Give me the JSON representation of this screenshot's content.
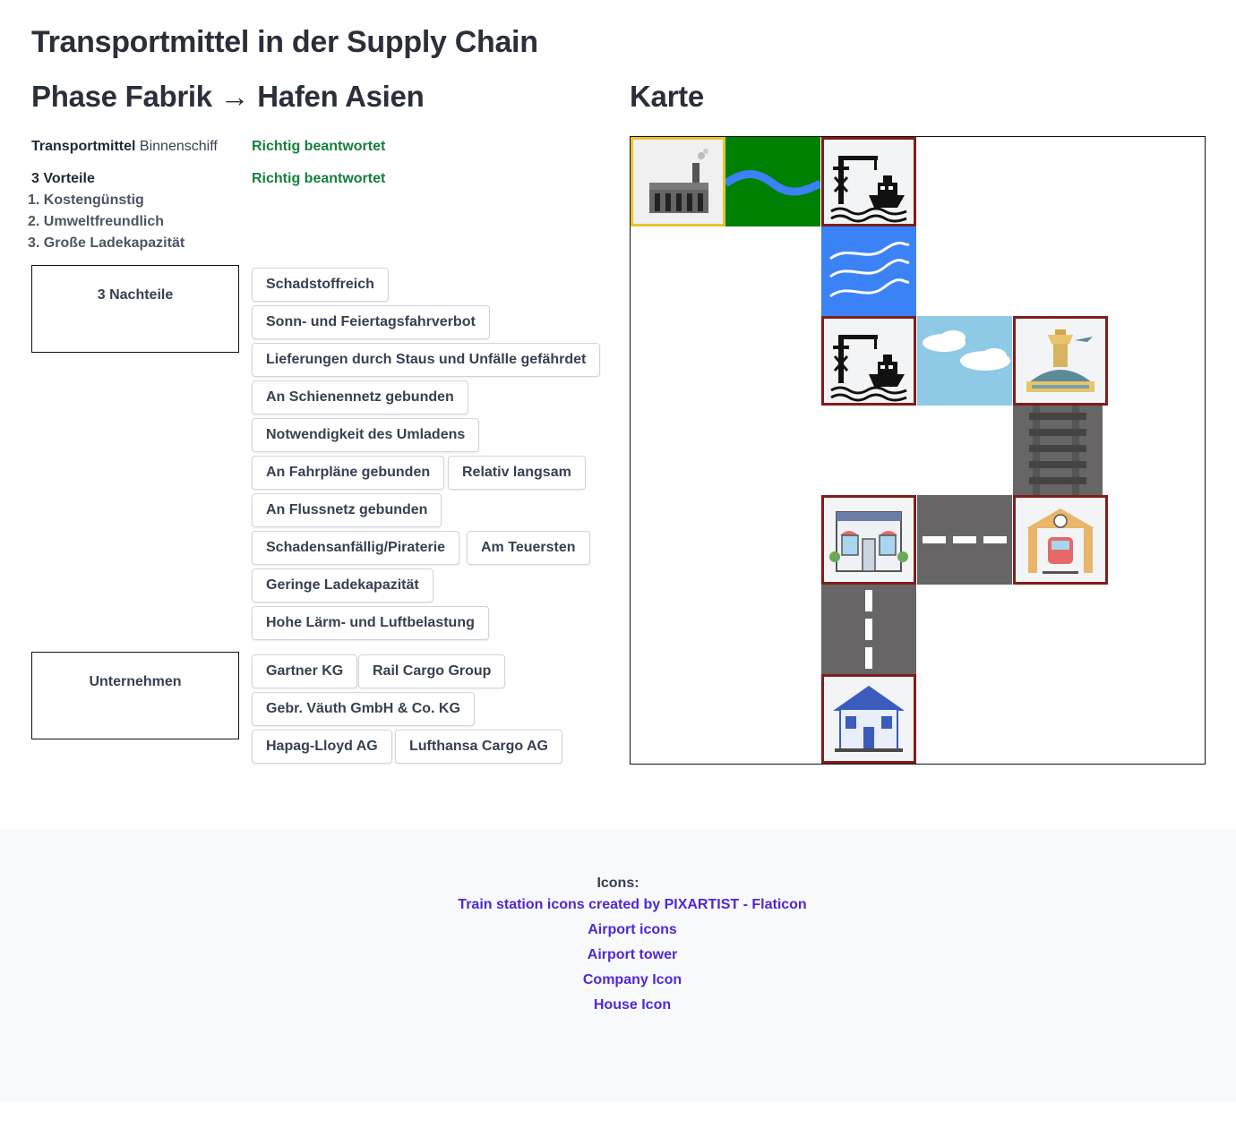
{
  "page": {
    "title": "Transportmittel in der Supply Chain",
    "phase_title": "Phase Fabrik → Hafen Asien",
    "map_title": "Karte"
  },
  "transport": {
    "label": "Transportmittel",
    "value": "Binnenschiff",
    "status": "Richtig beantwortet"
  },
  "advantages": {
    "label": "3 Vorteile",
    "status": "Richtig beantwortet",
    "items": [
      "1. Kostengünstig",
      "2. Umweltfreundlich",
      "3. Große Ladekapazität"
    ]
  },
  "disadvantages": {
    "dropzone_label": "3 Nachteile",
    "options": [
      "Schadstoffreich",
      "Sonn- und Feiertagsfahrverbot",
      "Lieferungen durch Staus und Unfälle gefährdet",
      "An Schienennetz gebunden",
      "Notwendigkeit des Umladens",
      "An Fahrpläne gebunden",
      "Relativ langsam",
      "An Flussnetz gebunden",
      "Schadensanfällig/Piraterie",
      "Am Teuersten",
      "Geringe Ladekapazität",
      "Hohe Lärm- und Luftbelastung"
    ]
  },
  "companies": {
    "dropzone_label": "Unternehmen",
    "options": [
      "Gartner KG",
      "Rail Cargo Group",
      "Gebr. Väuth GmbH & Co. KG",
      "Hapag-Lloyd AG",
      "Lufthansa Cargo AG"
    ]
  },
  "map": {
    "icons": [
      "factory-icon",
      "river-icon",
      "port-icon",
      "sea-icon",
      "port-icon",
      "sky-icon",
      "airport-icon",
      "rail-icon",
      "shop-icon",
      "road-icon",
      "train-station-icon",
      "road-icon",
      "house-icon"
    ],
    "colors": {
      "river_bg": "#008000",
      "river": "#3b82f6",
      "sea": "#3b82f6",
      "sky": "#8ecae6",
      "road": "#676566",
      "node_border": "#7f1d1d",
      "start_border": "#e6c52e"
    }
  },
  "footer": {
    "label": "Icons:",
    "links": [
      "Train station icons created by PIXARTIST - Flaticon",
      "Airport icons",
      "Airport tower",
      "Company Icon",
      "House Icon"
    ],
    "link_color": "#4f28d6"
  }
}
